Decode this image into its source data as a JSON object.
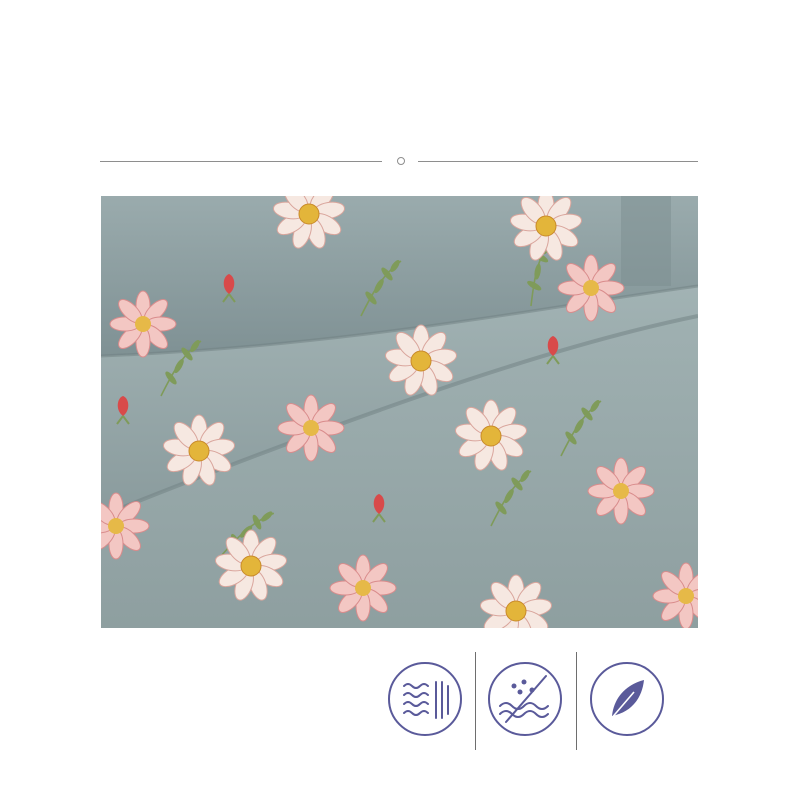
{
  "photo": {
    "subject": "floral-cotton-fabric",
    "colors": {
      "background": "#8e9fa0",
      "petal": "#f6e8e1",
      "petal_pink": "#e8a8a8",
      "center": "#e3b53a",
      "bud": "#d84a4a",
      "leaf": "#7f9b5a"
    }
  },
  "divider": {
    "color": "#8e8e8e"
  },
  "feature_icons": [
    {
      "icon": "breathable-waves-icon",
      "color": "#5a5a9a"
    },
    {
      "icon": "anti-pilling-icon",
      "color": "#5a5a9a"
    },
    {
      "icon": "leaf-soft-icon",
      "color": "#5a5a9a"
    }
  ]
}
